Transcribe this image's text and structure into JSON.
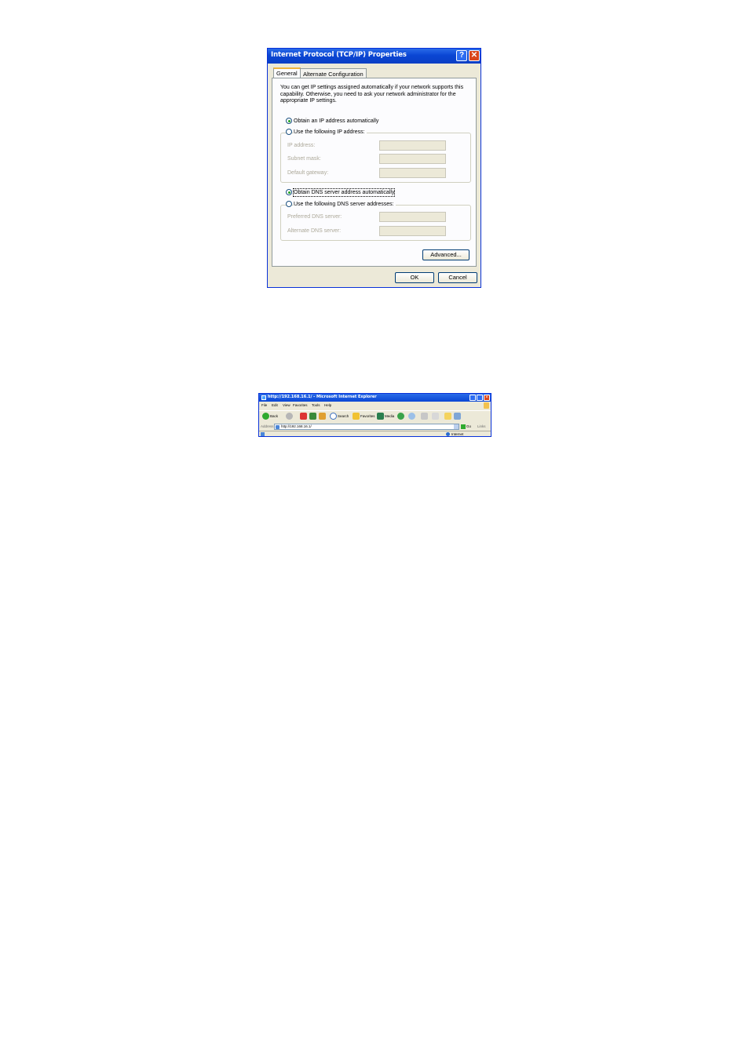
{
  "dialog": {
    "title": "Internet Protocol (TCP/IP) Properties",
    "help_glyph": "?",
    "close_glyph": "✕",
    "tabs": [
      {
        "label": "General"
      },
      {
        "label": "Alternate Configuration"
      }
    ],
    "description": "You can get IP settings assigned automatically if your network supports this capability. Otherwise, you need to ask your network administrator for the appropriate IP settings.",
    "obtain_ip_label": "Obtain an IP address automatically",
    "use_ip_label": "Use the following IP address:",
    "ip_address_label": "IP address:",
    "subnet_mask_label": "Subnet mask:",
    "default_gateway_label": "Default gateway:",
    "obtain_dns_label": "Obtain DNS server address automatically",
    "use_dns_label": "Use the following DNS server addresses:",
    "preferred_dns_label": "Preferred DNS server:",
    "alternate_dns_label": "Alternate DNS server:",
    "advanced_label": "Advanced...",
    "ok_label": "OK",
    "cancel_label": "Cancel"
  },
  "browser": {
    "title": "http://192.168.16.1/ - Microsoft Internet Explorer",
    "menu": [
      "File",
      "Edit",
      "View",
      "Favorites",
      "Tools",
      "Help"
    ],
    "back_label": "Back",
    "search_label": "Search",
    "favorites_label": "Favorites",
    "media_label": "Media",
    "address_label": "Address",
    "address_value": "http://192.168.16.1/",
    "go_label": "Go",
    "links_label": "Links",
    "status_zone": "Internet"
  }
}
